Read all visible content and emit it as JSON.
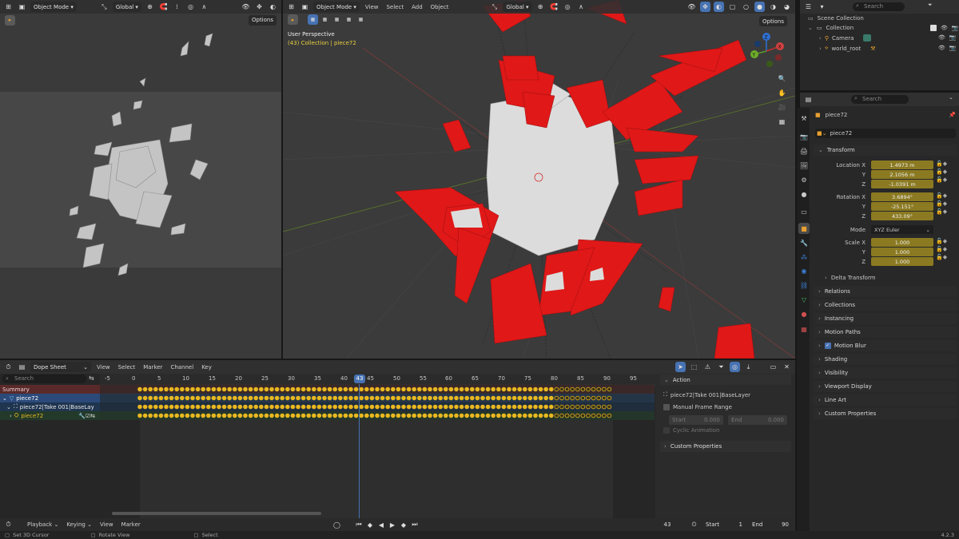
{
  "left_view": {
    "mode": "Object Mode",
    "orientation": "Global",
    "options": "Options"
  },
  "main_view": {
    "mode": "Object Mode",
    "menus": [
      "View",
      "Select",
      "Add",
      "Object"
    ],
    "orientation": "Global",
    "options": "Options",
    "overlay_title": "User Perspective",
    "overlay_sub": "(43) Collection | piece72"
  },
  "outliner": {
    "search_placeholder": "Search",
    "items": [
      {
        "label": "Scene Collection"
      },
      {
        "label": "Collection"
      },
      {
        "label": "Camera"
      },
      {
        "label": "world_root"
      }
    ]
  },
  "properties": {
    "search_placeholder": "Search",
    "object_name": "piece72",
    "datablock_name": "piece72",
    "transform_title": "Transform",
    "location_label": "Location X",
    "location": [
      "1.4973 m",
      "2.1056 m",
      "-1.0391 m"
    ],
    "rotation_label": "Rotation X",
    "rotation": [
      "3.6894°",
      "-25.151°",
      "433.09°"
    ],
    "mode_label": "Mode",
    "mode_value": "XYZ Euler",
    "scale_label": "Scale X",
    "scale": [
      "1.000",
      "1.000",
      "1.000"
    ],
    "axis_y": "Y",
    "axis_z": "Z",
    "delta": "Delta Transform",
    "sections": [
      "Relations",
      "Collections",
      "Instancing",
      "Motion Paths",
      "Motion Blur",
      "Shading",
      "Visibility",
      "Viewport Display",
      "Line Art",
      "Custom Properties"
    ]
  },
  "dopesheet": {
    "editor": "Dope Sheet",
    "menus": [
      "View",
      "Select",
      "Marker",
      "Channel",
      "Key"
    ],
    "search_placeholder": "Search",
    "ruler": [
      "-5",
      "0",
      "5",
      "10",
      "15",
      "20",
      "25",
      "30",
      "35",
      "40",
      "43",
      "45",
      "50",
      "55",
      "60",
      "65",
      "70",
      "75",
      "80",
      "85",
      "90",
      "95"
    ],
    "current_frame": "43",
    "channels": [
      "Summary",
      "piece72",
      "piece72|Take 001|BaseLay",
      "piece72"
    ],
    "action_title": "Action",
    "action_name": "piece72|Take 001|BaseLayer",
    "manual_range": "Manual Frame Range",
    "start_label": "Start",
    "start_value": "0.000",
    "end_label": "End",
    "end_value": "0.000",
    "cyclic": "Cyclic Animation",
    "custom_props": "Custom Properties"
  },
  "timeline": {
    "menus": [
      "Playback",
      "Keying",
      "View",
      "Marker"
    ],
    "frame": "43",
    "start_label": "Start",
    "start": "1",
    "end_label": "End",
    "end": "90"
  },
  "statusbar": {
    "hints": [
      "Set 3D Cursor",
      "Rotate View",
      "Select"
    ],
    "version": "4.2.3"
  },
  "colors": {
    "accent": "#4772b3",
    "keyframe": "#e8b820",
    "field": "#8b7a21",
    "red": "#e01818"
  }
}
